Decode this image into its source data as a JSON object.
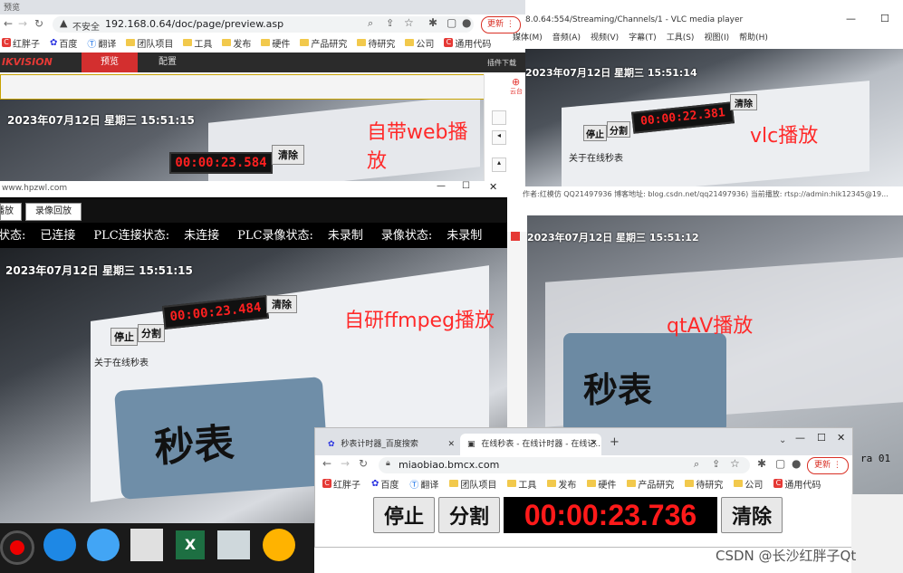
{
  "web_browser": {
    "tabbar_text": "预览",
    "not_secure": "不安全",
    "url": "192.168.0.64/doc/page/preview.asp",
    "update_label": "更新",
    "bookmarks": [
      "红胖子",
      "百度",
      "翻译",
      "团队项目",
      "工具",
      "发布",
      "硬件",
      "产品研究",
      "待研究",
      "公司",
      "通用代码"
    ],
    "brand": "IKVISION",
    "nav": [
      "预览",
      "配置"
    ],
    "plugin_text": "插件下载",
    "timestamp": "2023年07月12日  星期三  15:51:15",
    "overlay": "自带web播放",
    "timer_small": "00:00:23.584",
    "clear_small": "清除",
    "side_label": "云台"
  },
  "vlc": {
    "title": "8.0.64:554/Streaming/Channels/1 - VLC media player",
    "menus": [
      "媒体(M)",
      "音频(A)",
      "视频(V)",
      "字幕(T)",
      "工具(S)",
      "视图(I)",
      "帮助(H)"
    ],
    "timestamp": "2023年07月12日  星期三  15:51:14",
    "overlay": "vlc播放",
    "timer": "00:00:22.381",
    "stop": "停止",
    "split": "分割",
    "clear": "清除",
    "about": "关于在线秒表"
  },
  "qtav": {
    "info_bar": "作者:红模仿 QQ21497936 博客地址: blog.csdn.net/qq21497936) 当前播放: rtsp://admin:hik12345@19...",
    "timestamp": "2023年07月12日  星期三  15:51:12",
    "overlay": "qtAV播放",
    "stopwatch": "秒表",
    "camera_text": "ra 01"
  },
  "ffmpeg": {
    "title": "www.hpzwl.com",
    "tabs": [
      "播放",
      "录像回放"
    ],
    "status_items": [
      "连接状态:",
      "已连接",
      "PLC连接状态:",
      "未连接",
      "PLC录像状态:",
      "未录制",
      "录像状态:",
      "未录制"
    ],
    "timestamp": "2023年07月12日  星期三  15:51:15",
    "overlay": "自研ffmpeg播放",
    "stop": "停止",
    "split": "分割",
    "timer": "00:00:23.484",
    "clear": "清除",
    "about": "关于在线秒表",
    "stopwatch": "秒表"
  },
  "stopwatch_browser": {
    "tab1": "秒表计时器_百度搜索",
    "tab2": "在线秒表 - 在线计时器 - 在线记...",
    "url": "miaobiao.bmcx.com",
    "update_label": "更新",
    "bookmarks": [
      "红胖子",
      "百度",
      "翻译",
      "团队项目",
      "工具",
      "发布",
      "硬件",
      "产品研究",
      "待研究",
      "公司",
      "通用代码"
    ],
    "stop": "停止",
    "split": "分割",
    "timer": "00:00:23.736",
    "clear": "清除"
  },
  "watermark": "CSDN @长沙红胖子Qt",
  "taskbar": [
    "record-icon",
    "browser-icon",
    "player-icon",
    "app-icon",
    "excel-icon",
    "table-icon",
    "media-icon"
  ]
}
